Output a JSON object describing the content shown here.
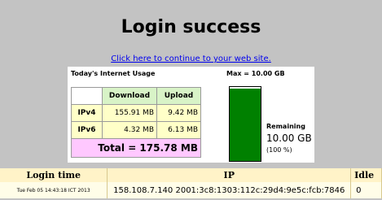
{
  "page": {
    "title": "Login success",
    "continue_link": "Click here to continue to your web site."
  },
  "usage": {
    "title": "Today's Internet Usage",
    "max_label": "Max = 10.00 GB",
    "columns": [
      "Download",
      "Upload"
    ],
    "rows": [
      {
        "type": "IPv4",
        "download": "155.91 MB",
        "upload": "9.42 MB"
      },
      {
        "type": "IPv6",
        "download": "4.32 MB",
        "upload": "6.13 MB"
      }
    ],
    "total": "Total = 175.78 MB",
    "remaining_label": "Remaining",
    "remaining_value": "10.00 GB",
    "remaining_percent_text": "(100 %)",
    "remaining_fraction": 0.98,
    "gauge_color": "#008000"
  },
  "sessions": {
    "columns": [
      "Login time",
      "IP",
      "Idle"
    ],
    "rows": [
      {
        "login_time": "Tue Feb 05 14:43:18 ICT 2013",
        "ip": "158.108.7.140 2001:3c8:1303:112c:29d4:9e5c:fcb:7846",
        "idle": "0"
      }
    ]
  },
  "colors": {
    "background": "#c3c3c3",
    "link": "#0000ee",
    "header_green": "#d8f3c7",
    "cell_yellow": "#ffffc8",
    "total_pink": "#ffc8ff",
    "session_header": "#fff3c8"
  }
}
